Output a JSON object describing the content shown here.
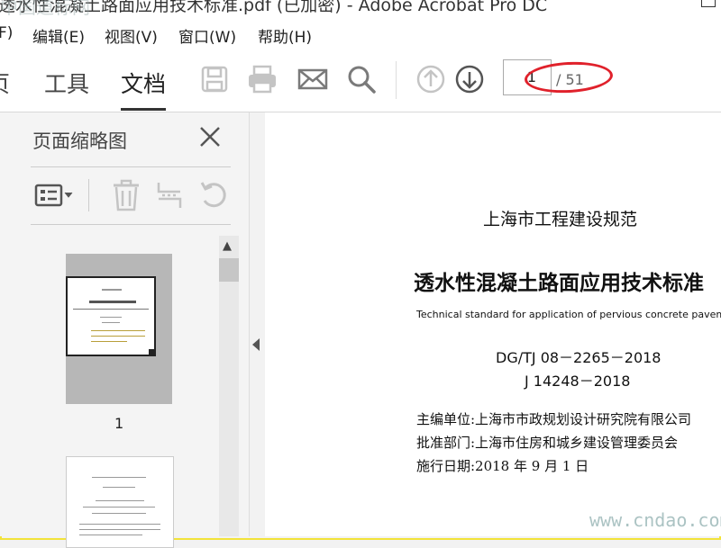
{
  "window": {
    "title": "透水性混凝土路面应用技术标准.pdf (已加密) - Adobe Acrobat Pro DC",
    "watermark_top": "中国道标网"
  },
  "menu": {
    "items": [
      {
        "name": "file",
        "label": "F)"
      },
      {
        "name": "edit",
        "label": "编辑(E)"
      },
      {
        "name": "view",
        "label": "视图(V)"
      },
      {
        "name": "window",
        "label": "窗口(W)"
      },
      {
        "name": "help",
        "label": "帮助(H)"
      }
    ]
  },
  "toolbar": {
    "tab_home": "页",
    "tab_tools": "工具",
    "tab_document": "文档",
    "icons": [
      "save-icon",
      "print-icon",
      "email-icon",
      "search-icon",
      "page-up-icon",
      "page-down-icon"
    ],
    "page_current": "1",
    "page_total": "/ 51"
  },
  "panel": {
    "title": "页面缩略图",
    "thumbnail_1_label": "1",
    "tools": [
      "thumbnail-options-icon",
      "delete-icon",
      "extract-icon",
      "rotate-icon"
    ]
  },
  "document": {
    "header": "上海市工程建设规范",
    "title": "透水性混凝土路面应用技术标准",
    "subtitle_en": "Technical standard for application of pervious concrete pavement",
    "code1": "DG/TJ 08－2265－2018",
    "code2": "J 14248－2018",
    "editor": "主编单位:上海市市政规划设计研究院有限公司",
    "approver": "批准部门:上海市住房和城乡建设管理委员会",
    "date": "施行日期:2018 年 9 月 1 日"
  },
  "watermark_bottom": "www.cndao.com",
  "colors": {
    "highlight": "#e0212b",
    "frame": "#f2e33a",
    "icon": "#7a7a7a",
    "icon_disabled": "#c4c4c4"
  }
}
